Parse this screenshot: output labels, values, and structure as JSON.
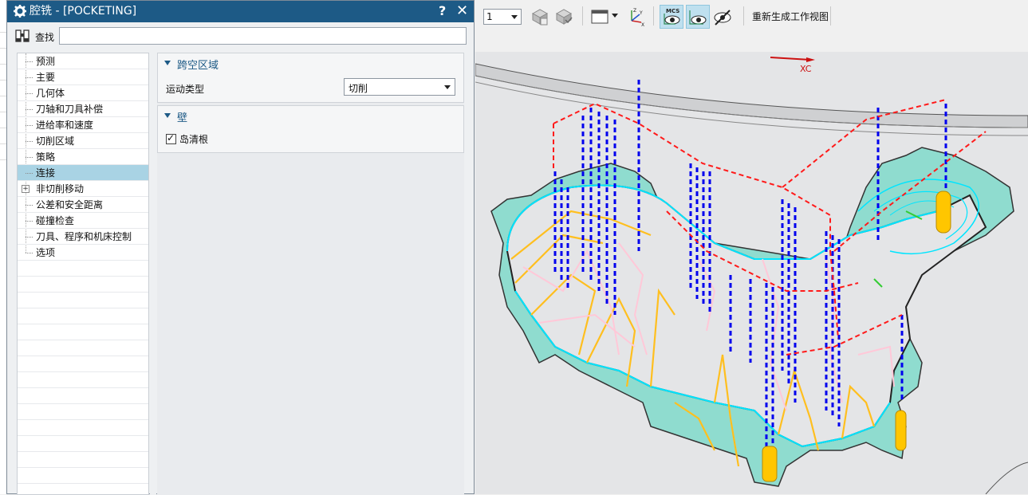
{
  "dialog": {
    "title": "腔铣 - [POCKETING]",
    "help": "?",
    "close": "✕",
    "find_label": "查找",
    "find_value": ""
  },
  "tree": {
    "items": [
      {
        "label": "预测",
        "selected": false,
        "expandable": false
      },
      {
        "label": "主要",
        "selected": false,
        "expandable": false
      },
      {
        "label": "几何体",
        "selected": false,
        "expandable": false
      },
      {
        "label": "刀轴和刀具补偿",
        "selected": false,
        "expandable": false
      },
      {
        "label": "进给率和速度",
        "selected": false,
        "expandable": false
      },
      {
        "label": "切削区域",
        "selected": false,
        "expandable": false
      },
      {
        "label": "策略",
        "selected": false,
        "expandable": false
      },
      {
        "label": "连接",
        "selected": true,
        "expandable": false
      },
      {
        "label": "非切削移动",
        "selected": false,
        "expandable": true
      },
      {
        "label": "公差和安全距离",
        "selected": false,
        "expandable": false
      },
      {
        "label": "碰撞检查",
        "selected": false,
        "expandable": false
      },
      {
        "label": "刀具、程序和机床控制",
        "selected": false,
        "expandable": false
      },
      {
        "label": "选项",
        "selected": false,
        "expandable": false
      }
    ]
  },
  "sections": {
    "transfer": {
      "title": "跨空区域",
      "motion_type_label": "运动类型",
      "motion_type_value": "切削"
    },
    "wall": {
      "title": "壁",
      "island_cleanup_label": "岛清根",
      "island_cleanup_checked": true
    }
  },
  "toolbar": {
    "layer_value": "1",
    "mcs_label": "MCS",
    "regenerate_label": "重新生成工作视图"
  },
  "viewport": {
    "axis_label": "XC"
  },
  "colors": {
    "titlebar": "#1d5a86",
    "selection": "#a9d3e4",
    "feed_blue": "#0000ff",
    "rapid_red": "#ff0000",
    "wall_cyan": "#00e5ff",
    "stepover_yellow": "#ffbf1f",
    "engage_pink": "#ffc8d8",
    "part_teal": "#7ed8cc"
  }
}
